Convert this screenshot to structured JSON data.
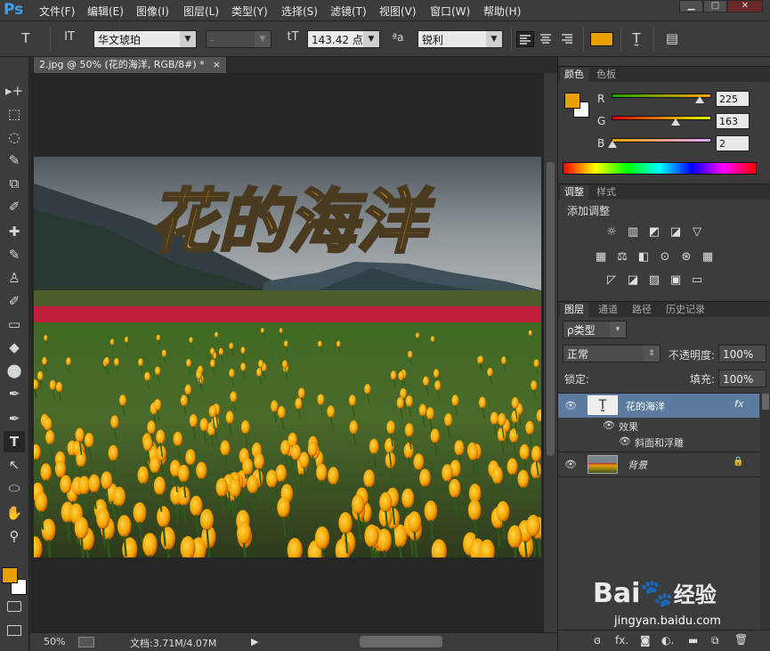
{
  "app": {
    "logo": "Ps"
  },
  "menu": [
    "文件(F)",
    "编辑(E)",
    "图像(I)",
    "图层(L)",
    "类型(Y)",
    "选择(S)",
    "滤镜(T)",
    "视图(V)",
    "窗口(W)",
    "帮助(H)"
  ],
  "window_controls": {
    "minimize": "▁",
    "maximize": "□",
    "close": "✕"
  },
  "options": {
    "font_family": "华文琥珀",
    "font_style": "-",
    "font_size": "143.42 点",
    "antialias": "锐利",
    "text_color": "#e8a100",
    "icons": {
      "tool": "T",
      "orient": "IT",
      "size": "tT",
      "aa": "ªa",
      "warp": "T̰",
      "panel": "▤"
    }
  },
  "document": {
    "tab_title": "2.jpg @ 50% (花的海洋, RGB/8#) *",
    "tab_close": "×",
    "artwork_text": "花的海洋",
    "zoom": "50%",
    "doc_size": "文档:3.71M/4.07M",
    "status_arrow": "▶"
  },
  "tools": [
    "▸+",
    "⬚",
    "◌",
    "✎",
    "⧉",
    "✐",
    "✚",
    "✎",
    "♙",
    "✐",
    "▭",
    "◆",
    "⬤",
    "✒",
    "T",
    "↖",
    "⬭",
    "✋",
    "⚲"
  ],
  "foreground_color": "#e8a100",
  "background_color": "#ffffff",
  "color_panel": {
    "tabs": [
      "颜色",
      "色板"
    ],
    "channels": [
      {
        "label": "R",
        "value": "225"
      },
      {
        "label": "G",
        "value": "163"
      },
      {
        "label": "B",
        "value": "2"
      }
    ]
  },
  "adjust_panel": {
    "tabs": [
      "调整",
      "样式"
    ],
    "title": "添加调整",
    "row1": [
      "☼",
      "▥",
      "◩",
      "◪",
      "▽"
    ],
    "row2": [
      "▦",
      "⚖",
      "◧",
      "⊙",
      "⊛",
      "▦"
    ],
    "row3": [
      "◸",
      "◪",
      "▨",
      "▣",
      "▭"
    ]
  },
  "layers_panel": {
    "tabs": [
      "图层",
      "通道",
      "路径",
      "历史记录"
    ],
    "filter": "ρ类型",
    "blend_mode": "正常",
    "opacity_label": "不透明度:",
    "opacity": "100%",
    "lock_label": "锁定:",
    "fill_label": "填充:",
    "fill": "100%",
    "layers": [
      {
        "name": "花的海洋",
        "fx": "fx"
      },
      {
        "name": "效果"
      },
      {
        "name": "斜面和浮雕"
      },
      {
        "name": "背景",
        "lock": "🔒"
      }
    ],
    "bottom_icons": [
      "ɞ",
      "fx.",
      "◙",
      "◐.",
      "▬",
      "⧉",
      "🗑"
    ]
  },
  "watermark": {
    "brand": "Bai",
    "brand2": "经验",
    "url": "jingyan.baidu.com"
  }
}
